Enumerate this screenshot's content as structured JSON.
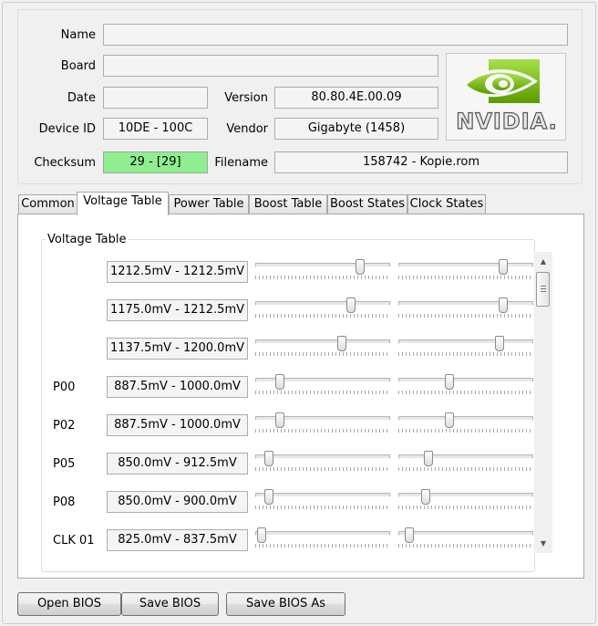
{
  "info": {
    "name_label": "Name",
    "name_value": "",
    "board_label": "Board",
    "board_value": "",
    "date_label": "Date",
    "date_value": "",
    "version_label": "Version",
    "version_value": "80.80.4E.00.09",
    "device_id_label": "Device ID",
    "device_id_value": "10DE - 100C",
    "vendor_label": "Vendor",
    "vendor_value": "Gigabyte (1458)",
    "checksum_label": "Checksum",
    "checksum_value": "29 - [29]",
    "filename_label": "Filename",
    "filename_value": "158742 - Kopie.rom",
    "logo_text": "NVIDIA."
  },
  "colors": {
    "checksum_ok": "#90ee90",
    "nvidia_green": "#76b900"
  },
  "tabs": [
    {
      "label": "Common"
    },
    {
      "label": "Voltage Table"
    },
    {
      "label": "Power Table"
    },
    {
      "label": "Boost Table"
    },
    {
      "label": "Boost States"
    },
    {
      "label": "Clock States"
    }
  ],
  "active_tab": "Voltage Table",
  "voltage_table": {
    "title": "Voltage Table",
    "rows": [
      {
        "label": "",
        "range": "1212.5mV - 1212.5mV",
        "min_level": 0.78,
        "max_level": 0.78
      },
      {
        "label": "",
        "range": "1175.0mV - 1212.5mV",
        "min_level": 0.71,
        "max_level": 0.78
      },
      {
        "label": "",
        "range": "1137.5mV - 1200.0mV",
        "min_level": 0.64,
        "max_level": 0.75
      },
      {
        "label": "P00",
        "range": "887.5mV - 1000.0mV",
        "min_level": 0.18,
        "max_level": 0.38
      },
      {
        "label": "P02",
        "range": "887.5mV - 1000.0mV",
        "min_level": 0.18,
        "max_level": 0.38
      },
      {
        "label": "P05",
        "range": "850.0mV - 912.5mV",
        "min_level": 0.1,
        "max_level": 0.22
      },
      {
        "label": "P08",
        "range": "850.0mV - 900.0mV",
        "min_level": 0.1,
        "max_level": 0.2
      },
      {
        "label": "CLK 01",
        "range": "825.0mV - 837.5mV",
        "min_level": 0.05,
        "max_level": 0.08
      }
    ]
  },
  "buttons": {
    "open": "Open BIOS",
    "save": "Save BIOS",
    "save_as": "Save BIOS As"
  }
}
